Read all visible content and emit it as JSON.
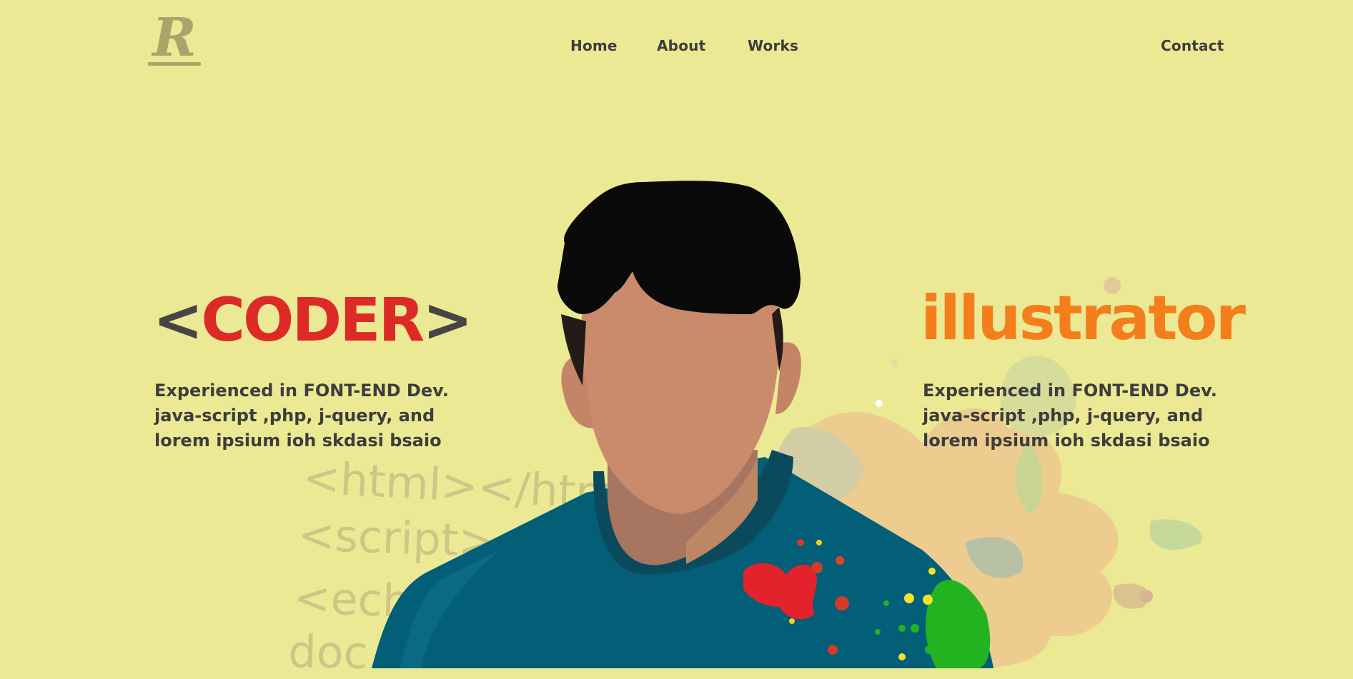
{
  "logo": {
    "letter": "R"
  },
  "nav": {
    "home": "Home",
    "about": "About",
    "works": "Works",
    "contact": "Contact"
  },
  "background_code": {
    "line1": "<html></html>",
    "line2": "<script>",
    "line3": "<echo",
    "line4": "doc"
  },
  "coder": {
    "bracket_open": "<",
    "title": "CODER",
    "bracket_close": ">",
    "line1": "Experienced in FONT-END Dev.",
    "line2": "java-script ,php, j-query, and",
    "line3": "lorem ipsium ioh skdasi bsaio"
  },
  "illustrator": {
    "title": "illustrator",
    "line1": "Experienced in FONT-END Dev.",
    "line2": "java-script ,php, j-query, and",
    "line3": "lorem ipsium ioh skdasi bsaio"
  },
  "colors": {
    "background": "#ece995",
    "coder_red": "#dc2a26",
    "illustrator_orange": "#f47e1c",
    "shirt": "#035e77",
    "skin": "#c98b6b",
    "hair": "#0a0a0a"
  }
}
